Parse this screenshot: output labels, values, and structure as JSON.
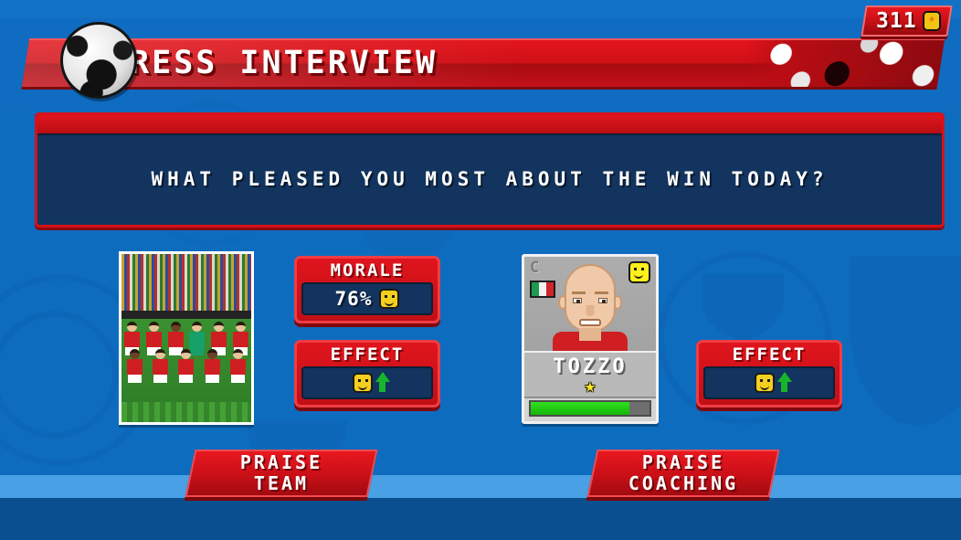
{
  "header": {
    "title": "PRESS INTERVIEW",
    "ball_icon": "soccer-ball-icon",
    "currency": {
      "value": "311",
      "icon": "coin-icon"
    }
  },
  "question": {
    "text": "WHAT PLEASED YOU MOST ABOUT THE WIN TODAY?"
  },
  "team_option": {
    "photo_alt": "team-squad-photo",
    "morale": {
      "label": "MORALE",
      "value": "76%",
      "mood_icon": "smiley-face-icon"
    },
    "effect": {
      "label": "EFFECT",
      "mood_icon": "smiley-face-icon",
      "direction_icon": "arrow-up-icon"
    },
    "button": {
      "line1": "PRAISE",
      "line2": "TEAM"
    }
  },
  "coach_option": {
    "card": {
      "role": "C",
      "nationality_icon": "italy-flag-icon",
      "mood_icon": "smiley-face-icon",
      "name": "TOZZO",
      "star_icon": "star-icon",
      "rating_percent": 83
    },
    "effect": {
      "label": "EFFECT",
      "mood_icon": "smiley-face-icon",
      "direction_icon": "arrow-up-icon"
    },
    "button": {
      "line1": "PRAISE",
      "line2": "COACHING"
    }
  },
  "colors": {
    "background_blue": "#0e6cbf",
    "panel_red": "#c20f16",
    "panel_dark_blue": "#12345e",
    "accent_yellow": "#f5cf1e",
    "positive_green": "#18b52c"
  }
}
